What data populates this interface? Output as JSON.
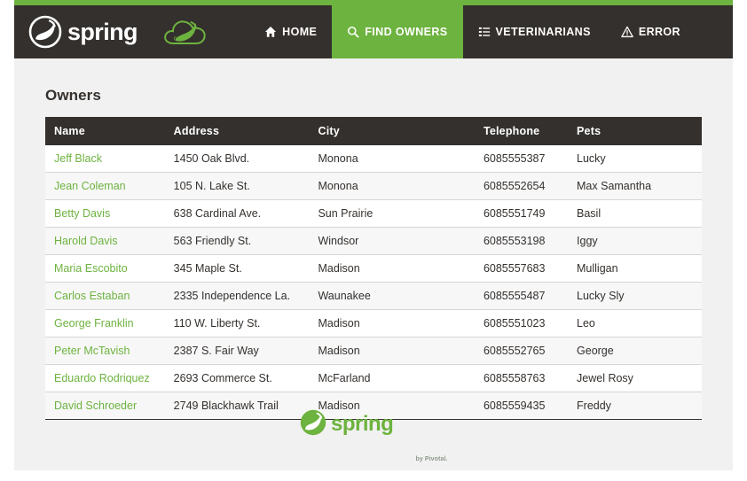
{
  "brand": {
    "name": "spring",
    "logo_icon": "spring-leaf-logo",
    "cloud_icon": "spring-cloud-binary-icon"
  },
  "nav": {
    "items": [
      {
        "label": "HOME",
        "icon": "home-icon",
        "active": false
      },
      {
        "label": "FIND OWNERS",
        "icon": "search-icon",
        "active": true
      },
      {
        "label": "VETERINARIANS",
        "icon": "list-icon",
        "active": false
      },
      {
        "label": "ERROR",
        "icon": "warning-triangle-icon",
        "active": false
      }
    ]
  },
  "main": {
    "title": "Owners",
    "table": {
      "columns": [
        "Name",
        "Address",
        "City",
        "Telephone",
        "Pets"
      ],
      "rows": [
        {
          "name": "Jeff Black",
          "address": "1450 Oak Blvd.",
          "city": "Monona",
          "telephone": "6085555387",
          "pets": "Lucky"
        },
        {
          "name": "Jean Coleman",
          "address": "105 N. Lake St.",
          "city": "Monona",
          "telephone": "6085552654",
          "pets": "Max Samantha"
        },
        {
          "name": "Betty Davis",
          "address": "638 Cardinal Ave.",
          "city": "Sun Prairie",
          "telephone": "6085551749",
          "pets": "Basil"
        },
        {
          "name": "Harold Davis",
          "address": "563 Friendly St.",
          "city": "Windsor",
          "telephone": "6085553198",
          "pets": "Iggy"
        },
        {
          "name": "Maria Escobito",
          "address": "345 Maple St.",
          "city": "Madison",
          "telephone": "6085557683",
          "pets": "Mulligan"
        },
        {
          "name": "Carlos Estaban",
          "address": "2335 Independence La.",
          "city": "Waunakee",
          "telephone": "6085555487",
          "pets": "Lucky Sly"
        },
        {
          "name": "George Franklin",
          "address": "110 W. Liberty St.",
          "city": "Madison",
          "telephone": "6085551023",
          "pets": "Leo"
        },
        {
          "name": "Peter McTavish",
          "address": "2387 S. Fair Way",
          "city": "Madison",
          "telephone": "6085552765",
          "pets": "George"
        },
        {
          "name": "Eduardo Rodriquez",
          "address": "2693 Commerce St.",
          "city": "McFarland",
          "telephone": "6085558763",
          "pets": "Jewel Rosy"
        },
        {
          "name": "David Schroeder",
          "address": "2749 Blackhawk Trail",
          "city": "Madison",
          "telephone": "6085559435",
          "pets": "Freddy"
        }
      ]
    }
  },
  "footer": {
    "brand": "spring",
    "byline": "by Pivotal.",
    "logo_icon": "spring-leaf-logo"
  },
  "colors": {
    "green": "#6db33f",
    "dark": "#34302d",
    "content_bg": "#f1f1f1",
    "row_alt": "#f7f7f7"
  }
}
